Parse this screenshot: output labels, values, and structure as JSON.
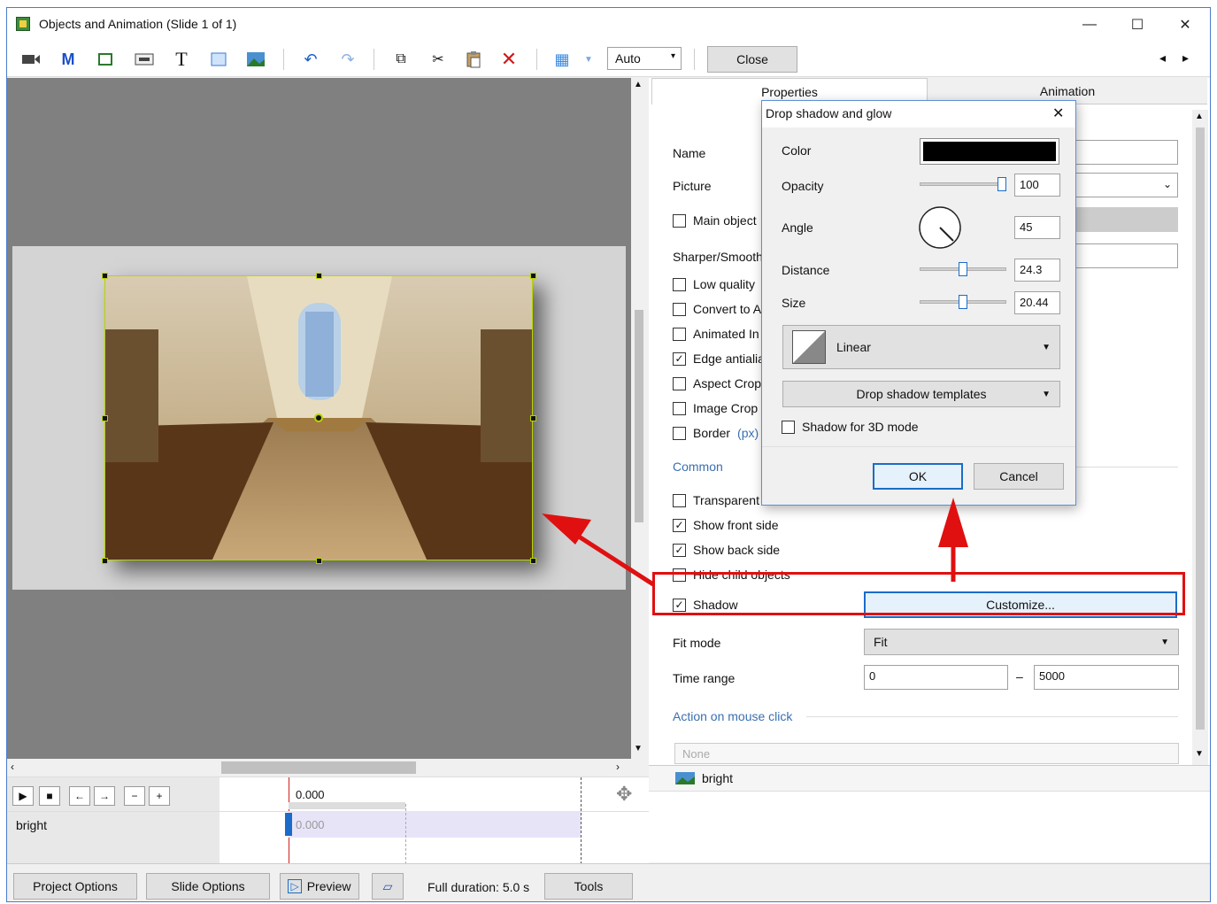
{
  "window": {
    "title": "Objects and Animation (Slide 1 of 1)",
    "minimize": "—",
    "maximize": "☐",
    "close": "✕"
  },
  "toolbar": {
    "zoom_value": "Auto",
    "close_label": "Close",
    "nav_prev": "◂",
    "nav_next": "▸",
    "icons": [
      "camera-icon",
      "mask-icon",
      "frame-icon",
      "button-icon",
      "text-icon",
      "rectangle-icon",
      "image-icon",
      "undo-icon",
      "redo-icon",
      "copy-icon",
      "cut-icon",
      "paste-icon",
      "delete-icon",
      "grid-icon"
    ]
  },
  "canvas": {
    "object_name": "bright"
  },
  "timeline": {
    "time_readout": "0.000",
    "track_label": "bright",
    "track_time": "0.000"
  },
  "panel": {
    "tabs": [
      "Properties",
      "Animation"
    ],
    "name_label": "Name",
    "picture_label": "Picture",
    "main_object_label": "Main object",
    "sharper_label": "Sharper/Smoothe",
    "checkboxes": [
      {
        "label": "Low quality",
        "checked": false
      },
      {
        "label": "Convert to A",
        "checked": false
      },
      {
        "label": "Animated In",
        "checked": false
      },
      {
        "label": "Edge antialia",
        "checked": true
      },
      {
        "label": "Aspect Crop",
        "checked": false
      },
      {
        "label": "Image Crop",
        "checked": false
      },
      {
        "label": "Border",
        "checked": false
      }
    ],
    "border_unit": "(px)",
    "common_label": "Common",
    "common_checkboxes": [
      {
        "label": "Transparent",
        "checked": false
      },
      {
        "label": "Show front side",
        "checked": true
      },
      {
        "label": "Show back side",
        "checked": true
      },
      {
        "label": "Hide child objects",
        "checked": false
      }
    ],
    "shadow_label": "Shadow",
    "shadow_checked": true,
    "customize_label": "Customize...",
    "fit_mode_label": "Fit mode",
    "fit_mode_value": "Fit",
    "time_range_label": "Time range",
    "time_range_start": "0",
    "time_range_dash": "–",
    "time_range_end": "5000",
    "action_label": "Action on mouse click",
    "action_value": "None",
    "object_list_item": "bright"
  },
  "dialog": {
    "title": "Drop shadow and glow",
    "color_label": "Color",
    "color_value": "#000000",
    "opacity_label": "Opacity",
    "opacity_value": "100",
    "opacity_fraction": 1.0,
    "angle_label": "Angle",
    "angle_value": "45",
    "distance_label": "Distance",
    "distance_value": "24.3",
    "distance_fraction": 0.5,
    "size_label": "Size",
    "size_value": "20.44",
    "size_fraction": 0.5,
    "gradient_value": "Linear",
    "templates_label": "Drop shadow templates",
    "shadow3d_label": "Shadow for 3D mode",
    "ok_label": "OK",
    "cancel_label": "Cancel"
  },
  "bottom": {
    "project_options": "Project Options",
    "slide_options": "Slide Options",
    "preview": "Preview",
    "duration": "Full duration: 5.0 s",
    "tools": "Tools"
  },
  "colors": {
    "accent": "#1a6cc8",
    "annotation_red": "#e01010",
    "selection_border": "#b8d400"
  }
}
